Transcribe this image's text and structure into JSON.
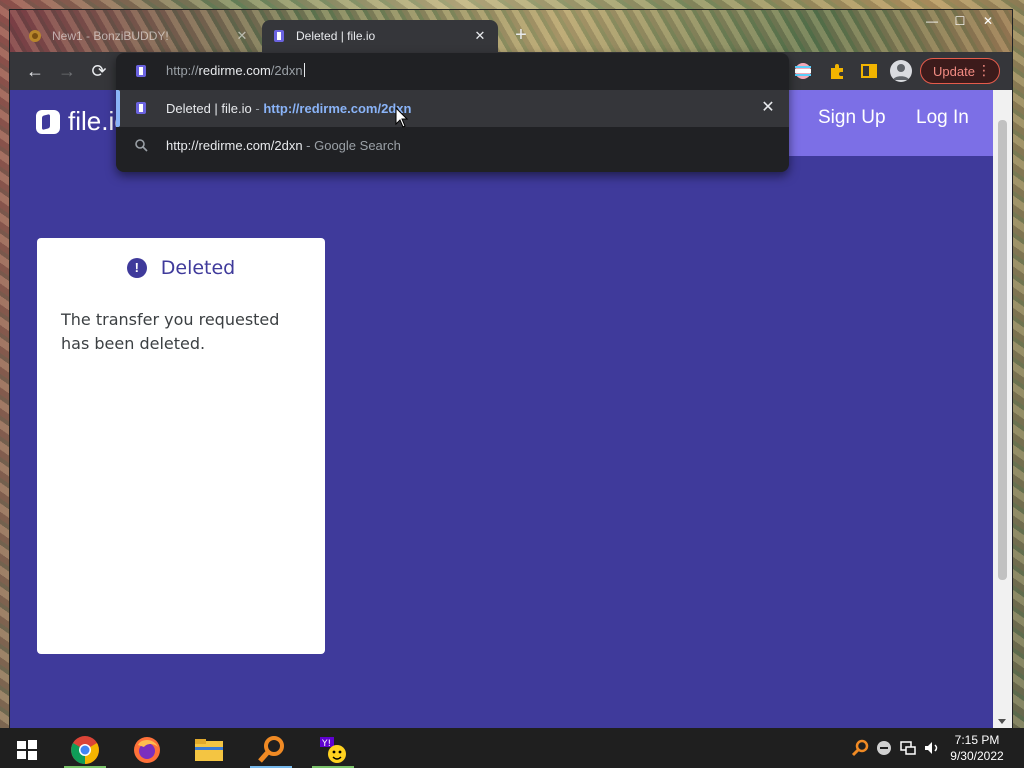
{
  "browser": {
    "tabs": [
      {
        "title": "New1 - BonziBUDDY!",
        "active": false
      },
      {
        "title": "Deleted | file.io",
        "active": true
      }
    ],
    "new_tab": "+",
    "window_controls": {
      "minimize": "—",
      "maximize": "☐",
      "close": "✕"
    },
    "update_label": "Update",
    "menu_glyph": "⋮"
  },
  "omnibox": {
    "input_prefix": "http://",
    "input_host": "redirme.com",
    "input_path": "/2dxn",
    "suggestions": [
      {
        "title": "Deleted | file.io",
        "separator": " - ",
        "url": "http://redirme.com/2dxn",
        "close": "✕"
      },
      {
        "query": "http://redirme.com/2dxn",
        "suffix": " - Google Search"
      }
    ]
  },
  "page": {
    "logo_text": "file.io",
    "signup": "Sign Up",
    "login": "Log In",
    "card": {
      "badge": "!",
      "heading": "Deleted",
      "body": "The transfer you requested has been deleted."
    }
  },
  "taskbar": {
    "time": "7:15 PM",
    "date": "9/30/2022"
  },
  "colors": {
    "page_bg": "#3f3a9b",
    "auth_bg": "#7c6fe6",
    "link_blue": "#8ab4f8",
    "update_red": "#f28b82"
  }
}
